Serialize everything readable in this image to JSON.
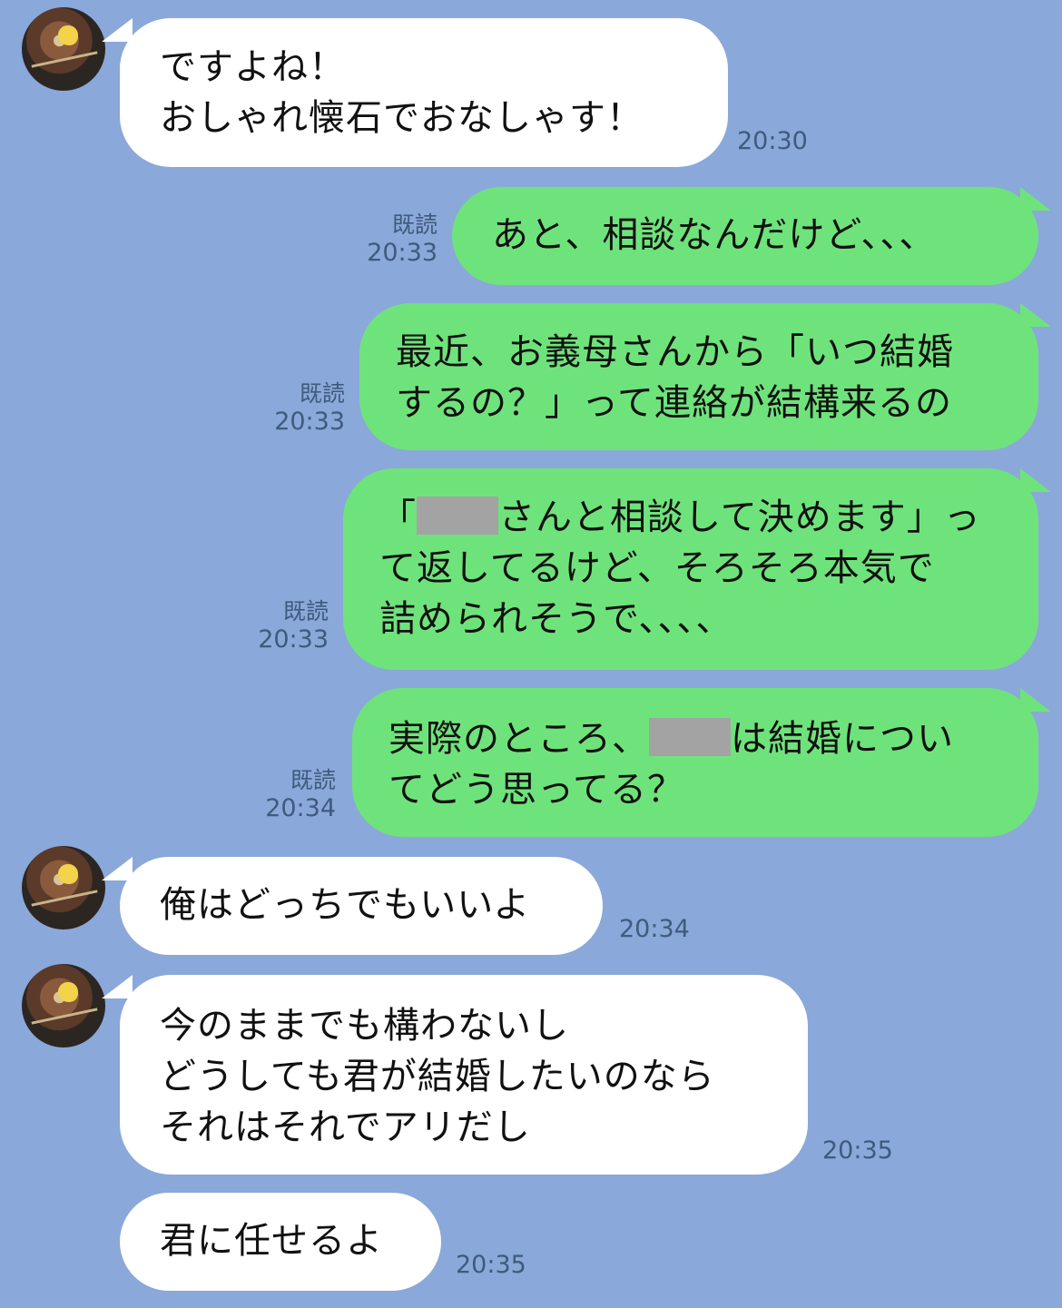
{
  "messages": [
    {
      "dir": "in",
      "text": "ですよね！\nおしゃれ懐石でおなしゃす！",
      "time": "20:30"
    },
    {
      "dir": "out",
      "read": "既読",
      "text": "あと、相談なんだけど、、、",
      "time": "20:33"
    },
    {
      "dir": "out",
      "read": "既読",
      "text": "最近、お義母さんから「いつ結婚\nするの？」って連絡が結構来るの",
      "time": "20:33"
    },
    {
      "dir": "out",
      "read": "既読",
      "text_before_mask": "「",
      "text_after_mask": "さんと相談して決めます」っ\nて返してるけど、そろそろ本気で\n詰められそうで、、、、",
      "time": "20:33"
    },
    {
      "dir": "out",
      "read": "既読",
      "text_before_mask": "実際のところ、",
      "text_after_mask": "は結婚につい\nてどう思ってる？",
      "time": "20:34"
    },
    {
      "dir": "in",
      "text": "俺はどっちでもいいよ",
      "time": "20:34"
    },
    {
      "dir": "in",
      "text": "今のままでも構わないし\nどうしても君が結婚したいのなら\nそれはそれでアリだし",
      "time": "20:35"
    },
    {
      "dir": "in",
      "text": "君に任せるよ",
      "time": "20:35"
    }
  ],
  "colors": {
    "background": "#8aa8d9",
    "incoming": "#ffffff",
    "outgoing": "#6fe37b",
    "mask": "#a3a3a3"
  }
}
